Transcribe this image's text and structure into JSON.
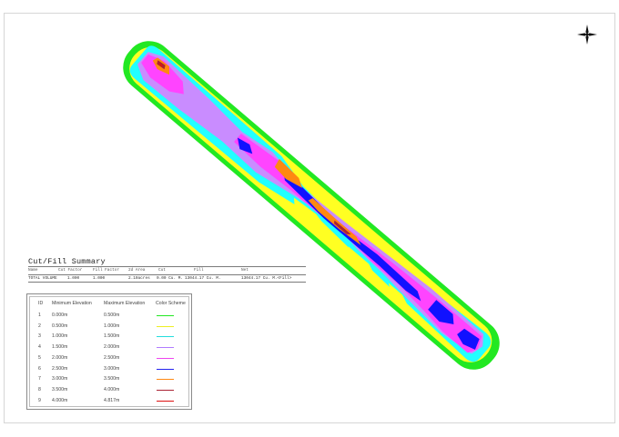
{
  "map": {
    "north_arrow_icon": "north-arrow-star-icon",
    "elevation_bands": [
      {
        "id": "1",
        "color": "#22e822"
      },
      {
        "id": "2",
        "color": "#ffff22"
      },
      {
        "id": "3",
        "color": "#22ffff"
      },
      {
        "id": "4",
        "color": "#c98cff"
      },
      {
        "id": "5",
        "color": "#ff44ff"
      },
      {
        "id": "6",
        "color": "#1111ff"
      },
      {
        "id": "7",
        "color": "#ff8811"
      },
      {
        "id": "8",
        "color": "#aa2233"
      },
      {
        "id": "9",
        "color": "#dd1111"
      }
    ]
  },
  "summary": {
    "title": "Cut/Fill Summary",
    "headers": [
      "Name",
      "Cut Factor",
      "Fill Factor",
      "2d Area",
      "Cut",
      "Fill",
      "Net"
    ],
    "row": [
      "TOTAL VOLUME",
      "1.000",
      "1.000",
      "2.10acres",
      "0.00 Cu. M.",
      "13044.17 Cu. M.",
      "13044.17 Cu. M.<Fill>"
    ]
  },
  "legend": {
    "headers": [
      "ID",
      "Minimum Elevation",
      "Maximum Elevation",
      "Color Scheme"
    ],
    "rows": [
      {
        "id": "1",
        "min": "0.000m",
        "max": "0.500m",
        "color": "#22e822"
      },
      {
        "id": "2",
        "min": "0.500m",
        "max": "1.000m",
        "color": "#eeee22"
      },
      {
        "id": "3",
        "min": "1.000m",
        "max": "1.500m",
        "color": "#22dddd"
      },
      {
        "id": "4",
        "min": "1.500m",
        "max": "2.000m",
        "color": "#b07cff"
      },
      {
        "id": "5",
        "min": "2.000m",
        "max": "2.500m",
        "color": "#ee44ee"
      },
      {
        "id": "6",
        "min": "2.500m",
        "max": "3.000m",
        "color": "#2222ee"
      },
      {
        "id": "7",
        "min": "3.000m",
        "max": "3.500m",
        "color": "#ff8811"
      },
      {
        "id": "8",
        "min": "3.500m",
        "max": "4.000m",
        "color": "#aa2233"
      },
      {
        "id": "9",
        "min": "4.000m",
        "max": "4.817m",
        "color": "#dd1111"
      }
    ]
  }
}
